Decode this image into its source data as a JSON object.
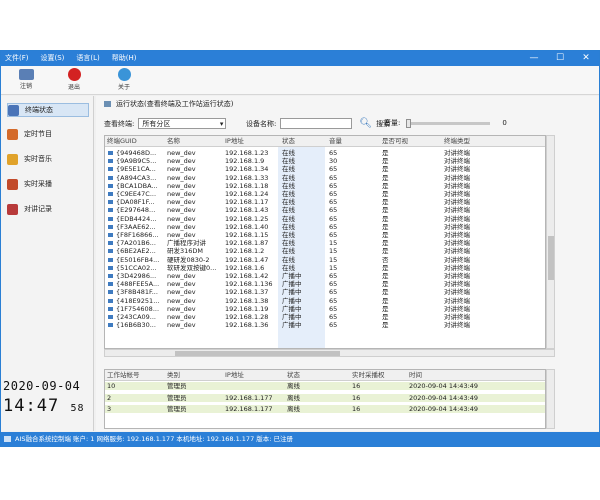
{
  "menubar": {
    "items": [
      "文件(F)",
      "设置(S)",
      "语言(L)",
      "帮助(H)"
    ]
  },
  "window_controls": {
    "minimize": "—",
    "maximize": "☐",
    "close": "✕"
  },
  "toolbar": {
    "buttons": [
      {
        "label": "注销",
        "icon": "logout-icon",
        "color": "#5a7fb5"
      },
      {
        "label": "退出",
        "icon": "power-icon",
        "color": "#d32222"
      },
      {
        "label": "关于",
        "icon": "info-icon",
        "color": "#3a94d8"
      }
    ]
  },
  "sidebar": {
    "items": [
      {
        "label": "终端状态",
        "icon": "monitor-icon",
        "color": "#4a74b8",
        "active": true
      },
      {
        "label": "定时节目",
        "icon": "calendar-icon",
        "color": "#d46a2a",
        "active": false
      },
      {
        "label": "实时音乐",
        "icon": "folder-icon",
        "color": "#e0a22a",
        "active": false
      },
      {
        "label": "实时采播",
        "icon": "broadcast-icon",
        "color": "#c24a2a",
        "active": false
      },
      {
        "label": "对讲记录",
        "icon": "record-icon",
        "color": "#b83a3a",
        "active": false
      }
    ]
  },
  "clock": {
    "date": "2020-09-04",
    "time": "14:47",
    "seconds": "58"
  },
  "main": {
    "header": "运行状态(查看终端及工作站运行状态)",
    "filter_label": "查看终端:",
    "filter_value": "所有分区",
    "name_label": "设备名称:",
    "name_value": "",
    "search_label": "搜索",
    "volume_label": "音量:",
    "volume_value": "0"
  },
  "terminal_table": {
    "columns": [
      "终端GUID",
      "名称",
      "IP地址",
      "状态",
      "音量",
      "是否可视",
      "终端类型"
    ],
    "rows": [
      [
        "{949468D...",
        "new_dev",
        "192.168.1.23",
        "在线",
        "65",
        "是",
        "对讲终端"
      ],
      [
        "{9A9B9C5...",
        "new_dev",
        "192.168.1.9",
        "在线",
        "30",
        "是",
        "对讲终端"
      ],
      [
        "{9E5E1CA...",
        "new_dev",
        "192.168.1.34",
        "在线",
        "65",
        "是",
        "对讲终端"
      ],
      [
        "{A894CA3...",
        "new_dev",
        "192.168.1.33",
        "在线",
        "65",
        "是",
        "对讲终端"
      ],
      [
        "{BCA1DBA...",
        "new_dev",
        "192.168.1.18",
        "在线",
        "65",
        "是",
        "对讲终端"
      ],
      [
        "{C9EE47C...",
        "new_dev",
        "192.168.1.24",
        "在线",
        "65",
        "是",
        "对讲终端"
      ],
      [
        "{DA08F1F...",
        "new_dev",
        "192.168.1.17",
        "在线",
        "65",
        "是",
        "对讲终端"
      ],
      [
        "{E297648...",
        "new_dev",
        "192.168.1.43",
        "在线",
        "65",
        "是",
        "对讲终端"
      ],
      [
        "{EDB4424...",
        "new_dev",
        "192.168.1.25",
        "在线",
        "65",
        "是",
        "对讲终端"
      ],
      [
        "{F3AAE62...",
        "new_dev",
        "192.168.1.40",
        "在线",
        "65",
        "是",
        "对讲终端"
      ],
      [
        "{F8F16866...",
        "new_dev",
        "192.168.1.15",
        "在线",
        "65",
        "是",
        "对讲终端"
      ],
      [
        "{7A201B6...",
        "广播程序对讲",
        "192.168.1.87",
        "在线",
        "15",
        "是",
        "对讲终端"
      ],
      [
        "{6BE2AE2...",
        "研发316DM",
        "192.168.1.2",
        "在线",
        "15",
        "是",
        "对讲终端"
      ],
      [
        "{E5016FB4...",
        "硬研发0830-2",
        "192.168.1.47",
        "在线",
        "15",
        "否",
        "对讲终端"
      ],
      [
        "{51CCA02...",
        "软研发双按键0...",
        "192.168.1.6",
        "在线",
        "15",
        "是",
        "对讲终端"
      ],
      [
        "{3D42986...",
        "new_dev",
        "192.168.1.42",
        "广播中",
        "65",
        "是",
        "对讲终端"
      ],
      [
        "{488FEE5A...",
        "new_dev",
        "192.168.1.136",
        "广播中",
        "65",
        "是",
        "对讲终端"
      ],
      [
        "{3F8B481F...",
        "new_dev",
        "192.168.1.37",
        "广播中",
        "65",
        "是",
        "对讲终端"
      ],
      [
        "{418E9251...",
        "new_dev",
        "192.168.1.38",
        "广播中",
        "65",
        "是",
        "对讲终端"
      ],
      [
        "{1F754608...",
        "new_dev",
        "192.168.1.19",
        "广播中",
        "65",
        "是",
        "对讲终端"
      ],
      [
        "{243CA09...",
        "new_dev",
        "192.168.1.28",
        "广播中",
        "65",
        "是",
        "对讲终端"
      ],
      [
        "{16B6B30...",
        "new_dev",
        "192.168.1.36",
        "广播中",
        "65",
        "是",
        "对讲终端"
      ]
    ]
  },
  "workstation_table": {
    "columns": [
      "工作站帐号",
      "类别",
      "IP地址",
      "状态",
      "实时采播权",
      "时间"
    ],
    "rows": [
      [
        "10",
        "管理员",
        "",
        "离线",
        "16",
        "2020-09-04 14:43:49"
      ],
      [
        "2",
        "管理员",
        "192.168.1.177",
        "离线",
        "16",
        "2020-09-04 14:43:49"
      ],
      [
        "3",
        "管理员",
        "192.168.1.177",
        "离线",
        "16",
        "2020-09-04 14:43:49"
      ]
    ]
  },
  "statusbar": {
    "text": "AIS融合系统控制端 账户: 1    网络服务: 192.168.1.177 本机地址: 192.168.1.177 版本: 已注册"
  }
}
